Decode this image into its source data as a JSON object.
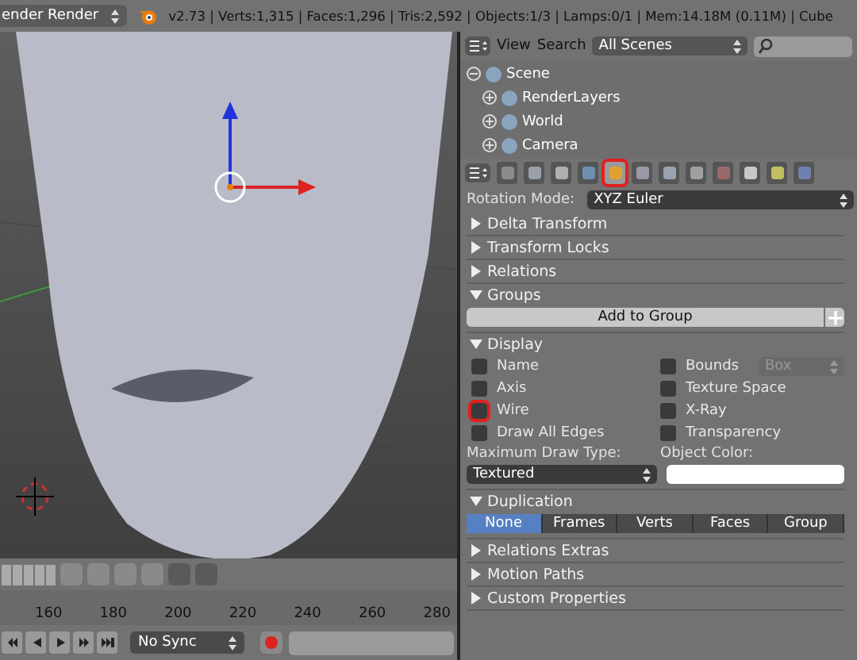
{
  "info_bar": {
    "render_engine": "ender Render",
    "stats": "v2.73 | Verts:1,315 | Faces:1,296 | Tris:2,592 | Objects:1/3 | Lamps:0/1 | Mem:14.18M (0.11M) | Cube"
  },
  "outliner": {
    "menus": [
      "View",
      "Search"
    ],
    "scene_filter": "All Scenes",
    "tree": [
      {
        "label": "Scene",
        "expanded": true,
        "children": [
          {
            "label": "RenderLayers",
            "expanded": false
          },
          {
            "label": "World",
            "expanded": false
          },
          {
            "label": "Camera",
            "expanded": false
          }
        ]
      }
    ]
  },
  "properties": {
    "tabs": [
      {
        "kind": "render",
        "selected": false,
        "highlighted": false
      },
      {
        "kind": "layers",
        "selected": false,
        "highlighted": false
      },
      {
        "kind": "scene",
        "selected": false,
        "highlighted": false
      },
      {
        "kind": "world",
        "selected": false,
        "highlighted": false
      },
      {
        "kind": "object",
        "selected": true,
        "highlighted": true
      },
      {
        "kind": "constraints",
        "selected": false,
        "highlighted": false
      },
      {
        "kind": "modifiers",
        "selected": false,
        "highlighted": false
      },
      {
        "kind": "data",
        "selected": false,
        "highlighted": false
      },
      {
        "kind": "material",
        "selected": false,
        "highlighted": false
      },
      {
        "kind": "texture",
        "selected": false,
        "highlighted": false
      },
      {
        "kind": "particles",
        "selected": false,
        "highlighted": false
      },
      {
        "kind": "physics",
        "selected": false,
        "highlighted": false
      }
    ],
    "rotation_mode": {
      "label": "Rotation Mode:",
      "value": "XYZ Euler"
    },
    "panels": [
      {
        "title": "Delta Transform",
        "expanded": false
      },
      {
        "title": "Transform Locks",
        "expanded": false
      },
      {
        "title": "Relations",
        "expanded": false
      },
      {
        "kind": "groups",
        "title": "Groups",
        "expanded": true,
        "button": "Add to Group"
      },
      {
        "kind": "display",
        "title": "Display",
        "expanded": true,
        "checkboxes": [
          {
            "label": "Name",
            "checked": false,
            "highlighted": false
          },
          {
            "label": "Bounds",
            "checked": false,
            "highlighted": false
          },
          {
            "label": "Axis",
            "checked": false,
            "highlighted": false
          },
          {
            "label": "Texture Space",
            "checked": false,
            "highlighted": false
          },
          {
            "label": "Wire",
            "checked": false,
            "highlighted": true
          },
          {
            "label": "X-Ray",
            "checked": false,
            "highlighted": false
          },
          {
            "label": "Draw All Edges",
            "checked": false,
            "highlighted": false
          },
          {
            "label": "Transparency",
            "checked": false,
            "highlighted": false
          }
        ],
        "bounds_type": "Box",
        "max_draw_type_label": "Maximum Draw Type:",
        "max_draw_type": "Textured",
        "object_color_label": "Object Color:"
      },
      {
        "kind": "duplication",
        "title": "Duplication",
        "expanded": true,
        "options": [
          {
            "label": "None",
            "selected": true
          },
          {
            "label": "Frames",
            "selected": false
          },
          {
            "label": "Verts",
            "selected": false
          },
          {
            "label": "Faces",
            "selected": false
          },
          {
            "label": "Group",
            "selected": false
          }
        ]
      },
      {
        "title": "Relations Extras",
        "expanded": false
      },
      {
        "title": "Motion Paths",
        "expanded": false
      },
      {
        "title": "Custom Properties",
        "expanded": false
      }
    ]
  },
  "timeline": {
    "ticks": [
      "160",
      "180",
      "200",
      "220",
      "240",
      "260",
      "280"
    ],
    "sync": "No Sync"
  }
}
